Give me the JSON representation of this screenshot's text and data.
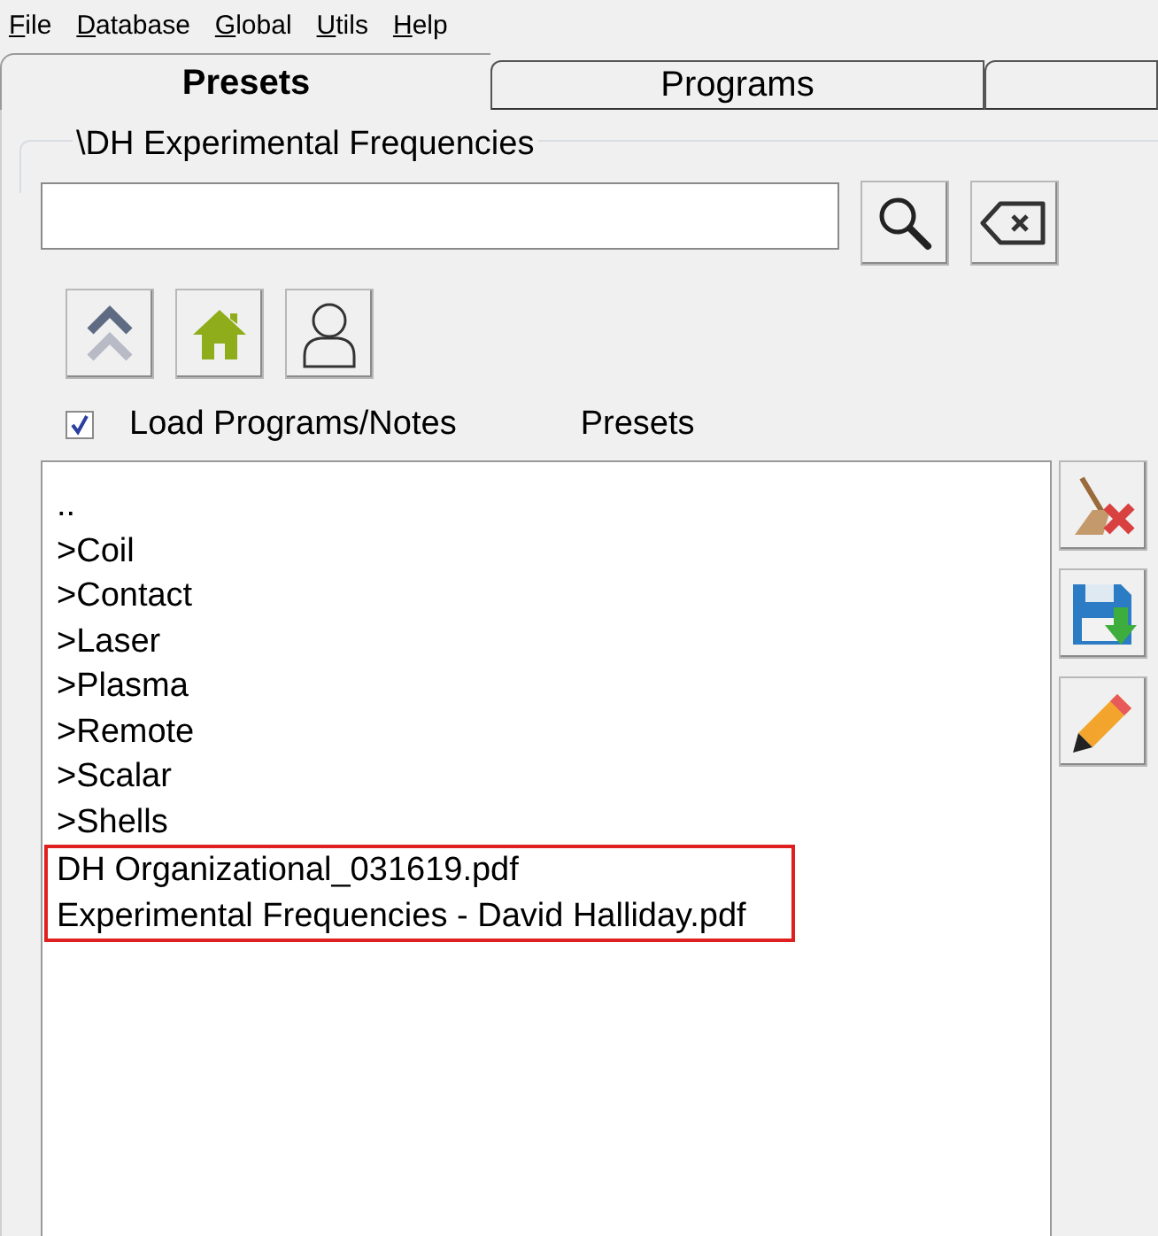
{
  "menu": [
    "File",
    "Database",
    "Global",
    "Utils",
    "Help"
  ],
  "tabs": [
    {
      "label": "Presets",
      "selected": true
    },
    {
      "label": "Programs",
      "selected": false
    },
    {
      "selected": false
    }
  ],
  "group_title": "\\DH Experimental Frequencies",
  "load_programs": {
    "label": "Load Programs/Notes",
    "checked": true
  },
  "list_label": "Presets",
  "list": [
    {
      "text": "..",
      "highlighted": false
    },
    {
      "text": ">Coil",
      "highlighted": false
    },
    {
      "text": ">Contact",
      "highlighted": false
    },
    {
      "text": ">Laser",
      "highlighted": false
    },
    {
      "text": ">Plasma",
      "highlighted": false
    },
    {
      "text": ">Remote",
      "highlighted": false
    },
    {
      "text": ">Scalar",
      "highlighted": false
    },
    {
      "text": ">Shells",
      "highlighted": false
    },
    {
      "text": "DH Organizational_031619.pdf",
      "highlighted": true
    },
    {
      "text": "Experimental Frequencies - David Halliday.pdf",
      "highlighted": true
    }
  ]
}
